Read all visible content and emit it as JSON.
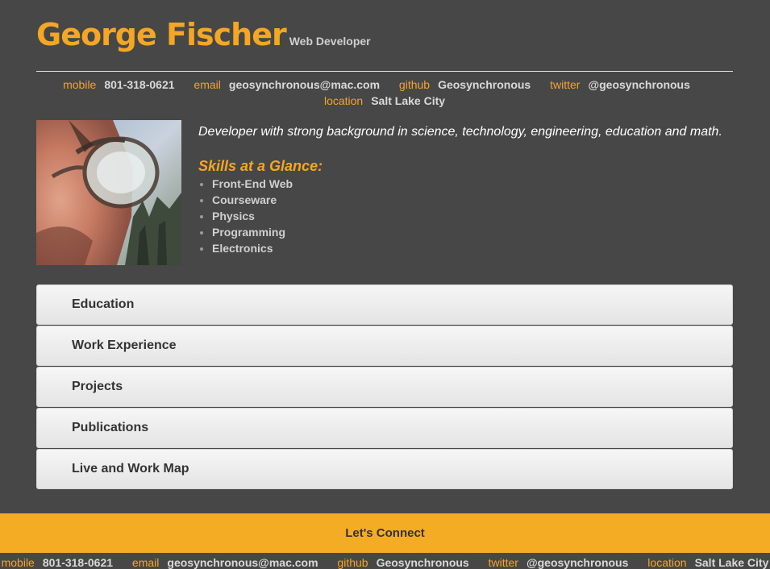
{
  "header": {
    "name": "George Fischer",
    "role": "Web Developer"
  },
  "contacts": [
    {
      "label": "mobile",
      "value": "801-318-0621"
    },
    {
      "label": "email",
      "value": "geosynchronous@mac.com"
    },
    {
      "label": "github",
      "value": "Geosynchronous"
    },
    {
      "label": "twitter",
      "value": "@geosynchronous"
    },
    {
      "label": "location",
      "value": "Salt Lake City"
    }
  ],
  "profile": {
    "summary": "Developer with strong background in science, technology, engineering, education and math.",
    "skills_title": "Skills at a Glance:",
    "skills": [
      "Front-End Web",
      "Courseware",
      "Physics",
      "Programming",
      "Electronics"
    ]
  },
  "sections": [
    "Education",
    "Work Experience",
    "Projects",
    "Publications",
    "Live and Work Map"
  ],
  "footer": {
    "connect_label": "Let's Connect"
  },
  "colors": {
    "accent": "#f5a623",
    "background": "#474747",
    "connect_bar": "#f5ac25"
  }
}
